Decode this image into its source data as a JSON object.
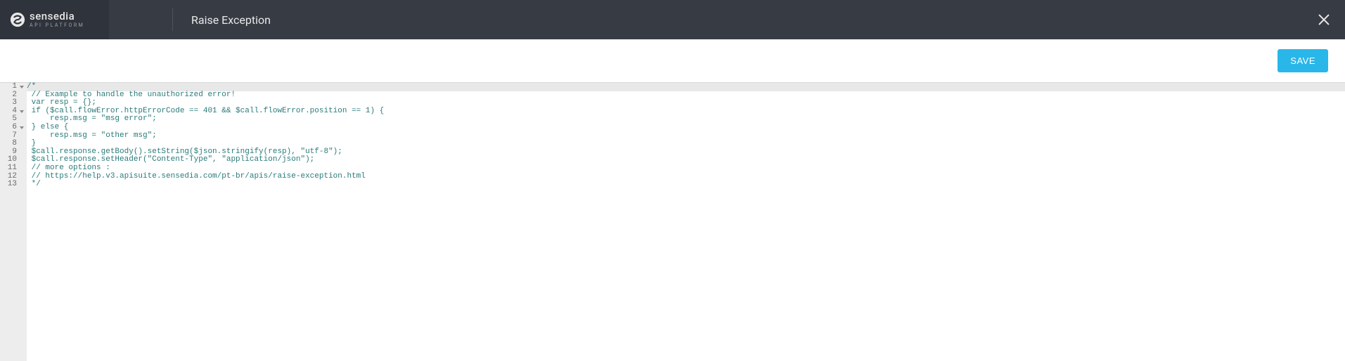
{
  "header": {
    "brand_name": "sensedia",
    "brand_sub": "API PLATFORM",
    "title": "Raise Exception"
  },
  "toolbar": {
    "save_label": "SAVE"
  },
  "editor": {
    "lines": [
      {
        "n": 1,
        "fold": true,
        "active": true,
        "text": "/*"
      },
      {
        "n": 2,
        "fold": false,
        "active": false,
        "text": " // Example to handle the unauthorized error!"
      },
      {
        "n": 3,
        "fold": false,
        "active": false,
        "text": " var resp = {};"
      },
      {
        "n": 4,
        "fold": true,
        "active": false,
        "text": " if ($call.flowError.httpErrorCode == 401 && $call.flowError.position == 1) {"
      },
      {
        "n": 5,
        "fold": false,
        "active": false,
        "text": "     resp.msg = \"msg error\";"
      },
      {
        "n": 6,
        "fold": true,
        "active": false,
        "text": " } else {"
      },
      {
        "n": 7,
        "fold": false,
        "active": false,
        "text": "     resp.msg = \"other msg\";"
      },
      {
        "n": 8,
        "fold": false,
        "active": false,
        "text": " }"
      },
      {
        "n": 9,
        "fold": false,
        "active": false,
        "text": " $call.response.getBody().setString($json.stringify(resp), \"utf-8\");"
      },
      {
        "n": 10,
        "fold": false,
        "active": false,
        "text": " $call.response.setHeader(\"Content-Type\", \"application/json\");"
      },
      {
        "n": 11,
        "fold": false,
        "active": false,
        "text": " // more options :"
      },
      {
        "n": 12,
        "fold": false,
        "active": false,
        "text": " // https://help.v3.apisuite.sensedia.com/pt-br/apis/raise-exception.html"
      },
      {
        "n": 13,
        "fold": false,
        "active": false,
        "text": " */"
      }
    ]
  }
}
